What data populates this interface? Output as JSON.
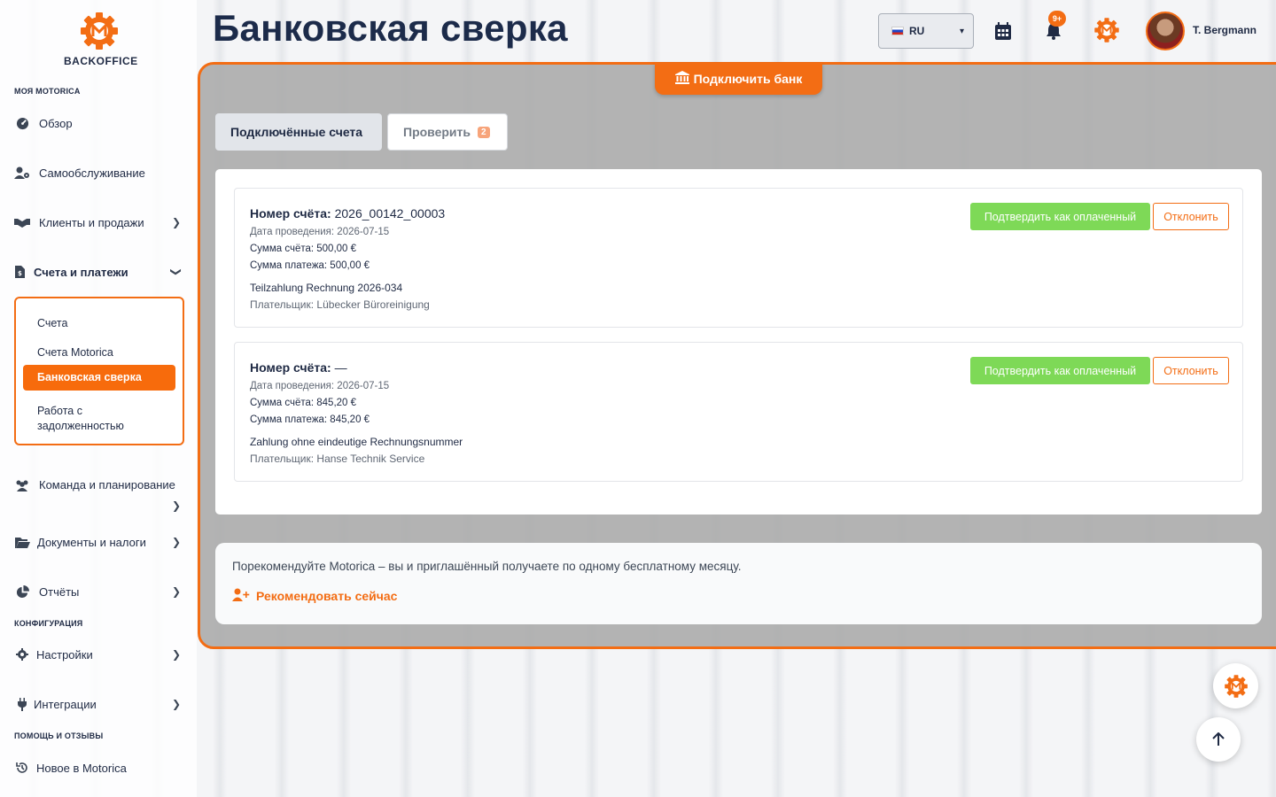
{
  "brand": {
    "logo_text": "BACKOFFICE",
    "accent": "#f36d14"
  },
  "header": {
    "title": "Банковская сверка",
    "language": "RU",
    "notifications_badge": "9+",
    "username": "T. Bergmann"
  },
  "sidebar": {
    "section_my": "МОЯ MOTORICA",
    "section_config": "КОНФИГУРАЦИЯ",
    "section_help": "ПОМОЩЬ И ОТЗЫВЫ",
    "items": {
      "overview": "Обзор",
      "selfservice": "Самообслуживание",
      "clients": "Клиенты и продажи",
      "invoices": "Счета и платежи",
      "team": "Команда и планирование",
      "documents": "Документы и налоги",
      "reports": "Отчёты",
      "settings": "Настройки",
      "integrations": "Интеграции",
      "whatsnew": "Новое в Motorica"
    },
    "submenu": {
      "invoices": "Счета",
      "motorica_invoices": "Счета Motorica",
      "bank_reconciliation": "Банковская сверка",
      "debt_management": "Работа с задолженностью"
    }
  },
  "main": {
    "connect_bank": "Подключить банк",
    "tabs": {
      "connected": "Подключённые счета",
      "review": "Проверить",
      "review_count": "2"
    },
    "transactions": [
      {
        "account_label": "Номер счёта:",
        "account_number": "2026_00142_00003",
        "date": "Дата проведения: 2026-07-15",
        "invoice_amount": "Сумма счёта: 500,00 €",
        "payment_amount": "Сумма платежа: 500,00 €",
        "reference": "Teilzahlung Rechnung 2026-034",
        "payer": "Плательщик: Lübecker Büroreinigung",
        "confirm": "Подтвердить как оплаченный",
        "reject": "Отклонить"
      },
      {
        "account_label": "Номер счёта:",
        "account_number": "—",
        "date": "Дата проведения: 2026-07-15",
        "invoice_amount": "Сумма счёта: 845,20 €",
        "payment_amount": "Сумма платежа: 845,20 €",
        "reference": "Zahlung ohne eindeutige Rechnungsnummer",
        "payer": "Плательщик: Hanse Technik Service",
        "confirm": "Подтвердить как оплаченный",
        "reject": "Отклонить"
      }
    ],
    "referral": {
      "text": "Порекомендуйте Motorica – вы и приглашённый получаете по одному бесплатному месяцу.",
      "link": "Рекомендовать сейчас"
    }
  }
}
